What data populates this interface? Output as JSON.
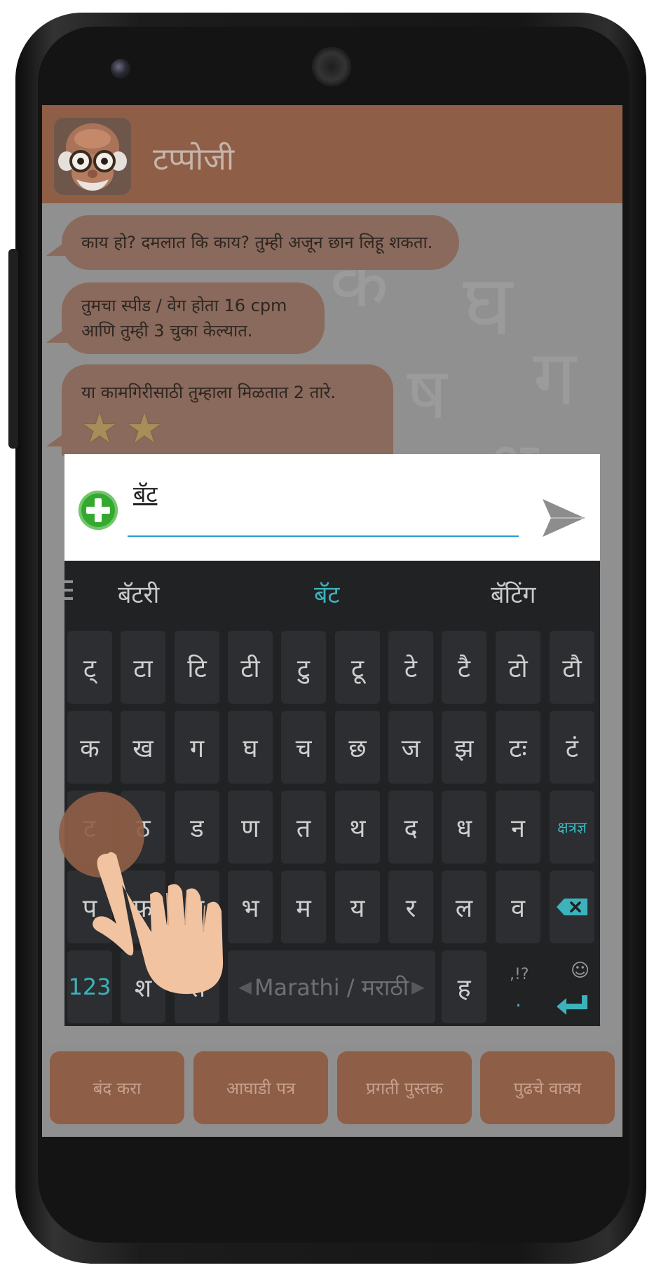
{
  "app": {
    "title": "टप्पोजी"
  },
  "chat": {
    "messages": [
      {
        "lines": [
          "काय हो? दमलात कि काय? तुम्ही अजून छान लिहू शकता."
        ]
      },
      {
        "lines": [
          "तुमचा स्पीड / वेग होता 16 cpm",
          "आणि तुम्ही 3 चुका केल्यात."
        ]
      },
      {
        "lines": [
          "या कामगिरीसाठी तुम्हाला मिळतात 2 तारे."
        ],
        "stars": 2
      }
    ]
  },
  "input": {
    "value": "बॅट"
  },
  "keyboard": {
    "suggestions": [
      "बॅटरी",
      "बॅट",
      "बॅटिंग"
    ],
    "rows": [
      [
        "ट्",
        "टा",
        "टि",
        "टी",
        "टु",
        "टू",
        "टे",
        "टै",
        "टो",
        "टौ"
      ],
      [
        "क",
        "ख",
        "ग",
        "घ",
        "च",
        "छ",
        "ज",
        "झ",
        "टः",
        "टं"
      ],
      [
        "ट",
        "ठ",
        "ड",
        "ण",
        "त",
        "थ",
        "द",
        "ध",
        "न",
        "क्षत्रज्ञ"
      ],
      [
        "प",
        "फ",
        "ब",
        "भ",
        "म",
        "य",
        "र",
        "ल",
        "व"
      ]
    ],
    "bottom_row": {
      "numbers": "123",
      "key2": "श",
      "key3": "स",
      "space": "Marathi / मराठी",
      "key_h": "ह",
      "punct": ",!?",
      "dot": "."
    }
  },
  "bottom_buttons": [
    "बंद करा",
    "आघाडी पत्र",
    "प्रगती पुस्तक",
    "पुढचे वाक्य"
  ],
  "colors": {
    "brand": "#8f5e47",
    "accent": "#3cb3bc",
    "input_line": "#2a9ad6",
    "plus_green": "#35a92f"
  }
}
